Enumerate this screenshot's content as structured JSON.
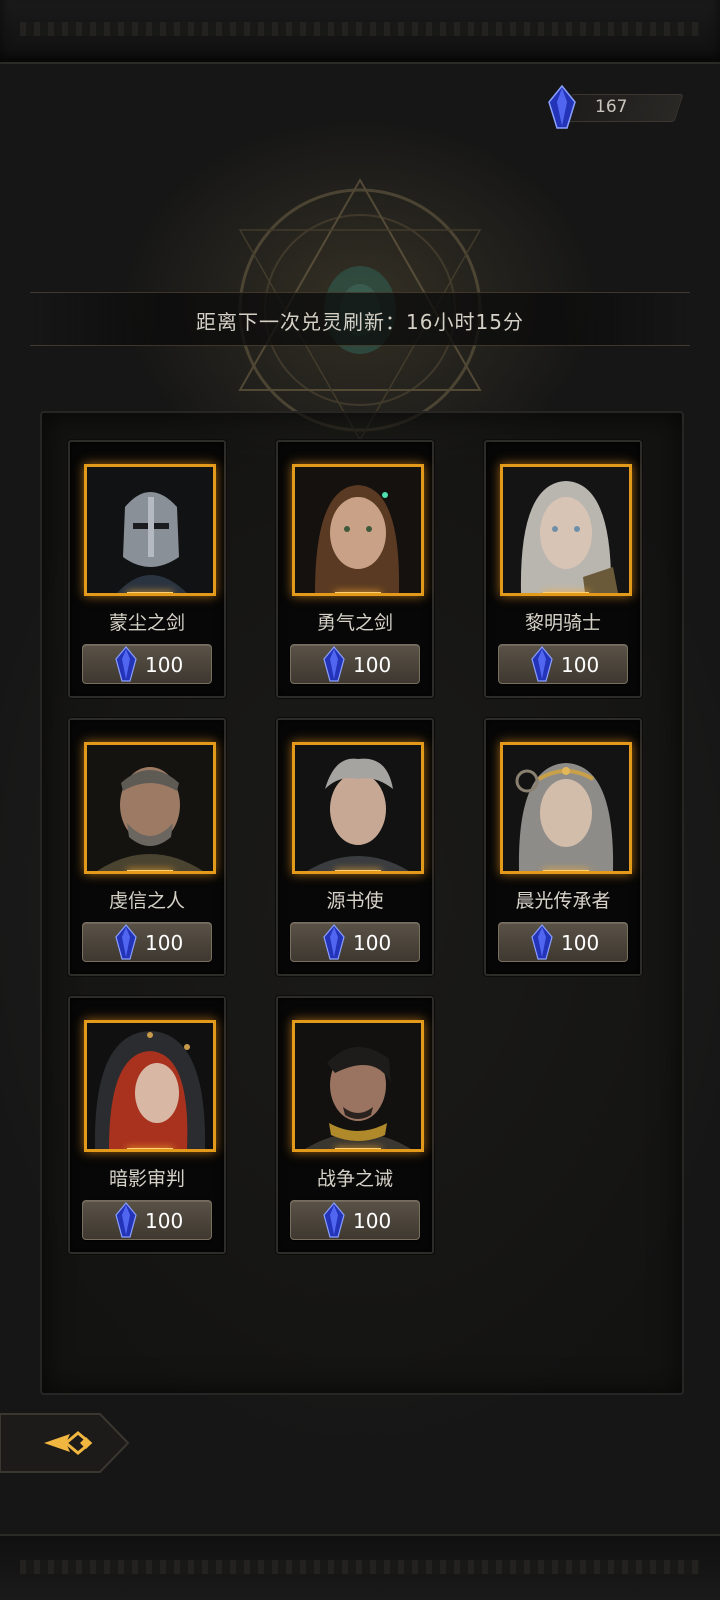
{
  "currency": {
    "icon": "blue-crystal-icon",
    "value": "167"
  },
  "timer": {
    "text": "距离下一次兑灵刷新：16小时15分"
  },
  "cards": [
    {
      "name": "蒙尘之剑",
      "cost": "100",
      "portrait": "helmeted-knight-portrait"
    },
    {
      "name": "勇气之剑",
      "cost": "100",
      "portrait": "brown-haired-woman-portrait"
    },
    {
      "name": "黎明骑士",
      "cost": "100",
      "portrait": "silver-haired-woman-portrait"
    },
    {
      "name": "虔信之人",
      "cost": "100",
      "portrait": "bearded-man-portrait"
    },
    {
      "name": "源书使",
      "cost": "100",
      "portrait": "silver-haired-youth-portrait"
    },
    {
      "name": "晨光传承者",
      "cost": "100",
      "portrait": "crowned-woman-portrait"
    },
    {
      "name": "暗影审判",
      "cost": "100",
      "portrait": "hooded-red-haired-woman-portrait"
    },
    {
      "name": "战争之诫",
      "cost": "100",
      "portrait": "dark-haired-warrior-portrait"
    }
  ],
  "colors": {
    "accent_gold": "#e39a1a",
    "crystal_blue": "#3a4ee0",
    "text": "#d6d2c8"
  },
  "back_button": {
    "icon": "back-arrow-icon"
  }
}
